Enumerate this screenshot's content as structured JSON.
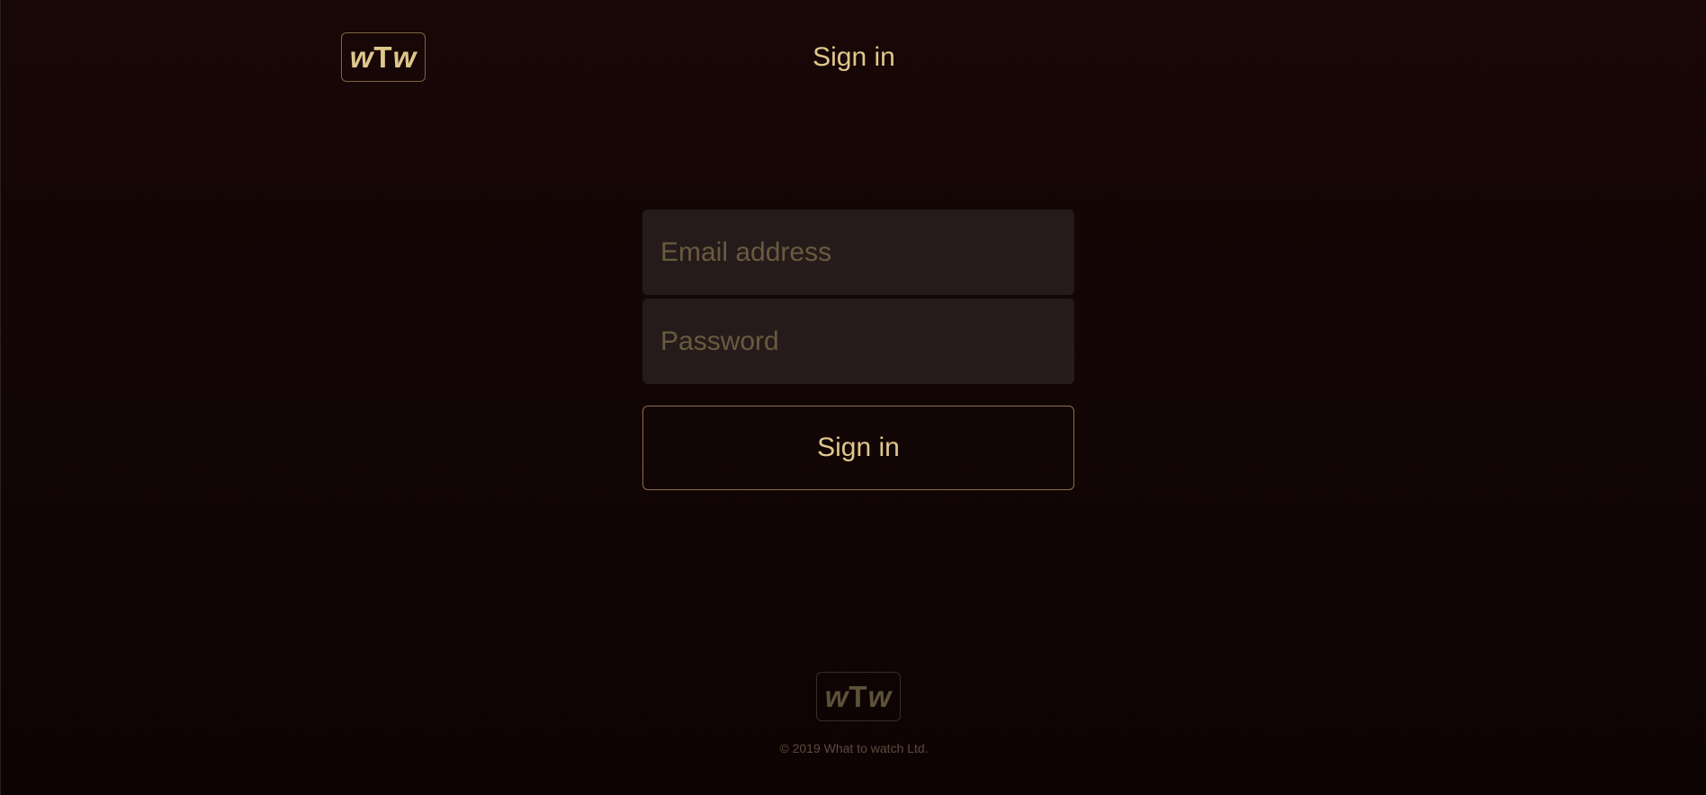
{
  "header": {
    "logo": {
      "part1": "w",
      "part2": "T",
      "part3": "w"
    },
    "title": "Sign in"
  },
  "form": {
    "email": {
      "placeholder": "Email address",
      "value": ""
    },
    "password": {
      "placeholder": "Password",
      "value": ""
    },
    "submit_label": "Sign in"
  },
  "footer": {
    "logo": {
      "part1": "w",
      "part2": "T",
      "part3": "w"
    },
    "copyright": "© 2019 What to watch Ltd."
  },
  "colors": {
    "accent": "#dfc78c",
    "background": "#180707",
    "field_background": "#261b1b",
    "muted": "#5d5138"
  }
}
